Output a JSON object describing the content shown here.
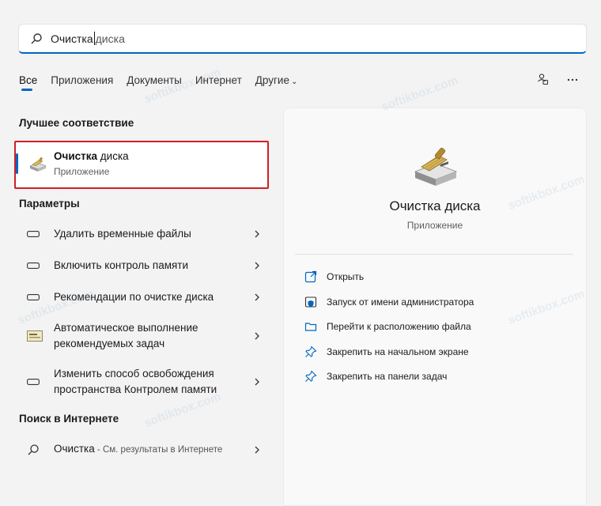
{
  "search": {
    "typed": "Очистка",
    "rest": "диска"
  },
  "tabs": [
    "Все",
    "Приложения",
    "Документы",
    "Интернет",
    "Другие"
  ],
  "sections": {
    "best_match": "Лучшее соответствие",
    "settings": "Параметры",
    "web": "Поиск в Интернете"
  },
  "best_match": {
    "title_bold": "Очистка",
    "title_rest": " диска",
    "subtitle": "Приложение"
  },
  "settings": [
    {
      "label": "Удалить временные файлы"
    },
    {
      "label": "Включить контроль памяти"
    },
    {
      "label": "Рекомендации по очистке диска"
    },
    {
      "label": "Автоматическое выполнение рекомендуемых задач"
    },
    {
      "label": "Изменить способ освобождения пространства Контролем памяти"
    }
  ],
  "web_result": {
    "query": "Очистка",
    "suffix": " - См. результаты в Интернете"
  },
  "details": {
    "title": "Очистка диска",
    "subtitle": "Приложение"
  },
  "actions": [
    {
      "label": "Открыть",
      "icon": "open-icon"
    },
    {
      "label": "Запуск от имени администратора",
      "icon": "shield-icon"
    },
    {
      "label": "Перейти к расположению файла",
      "icon": "folder-icon"
    },
    {
      "label": "Закрепить на начальном экране",
      "icon": "pin-icon"
    },
    {
      "label": "Закрепить на панели задач",
      "icon": "pin-icon"
    }
  ],
  "watermark": "softikbox.com",
  "colors": {
    "accent": "#0067c0",
    "highlight_border": "#cf1f24"
  }
}
